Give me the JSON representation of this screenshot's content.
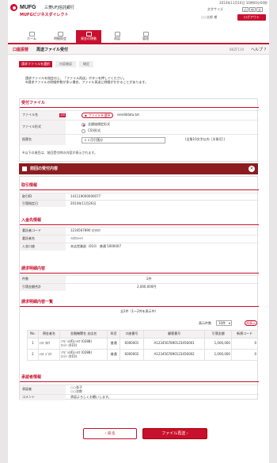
{
  "header": {
    "logo_text": "MUFG",
    "bank_name": "三菱UFJ信託銀行",
    "service_name": "MUFGビジネスダイレクト",
    "datetime": "2014年11月16日 10時00分00秒",
    "font_size_label": "文字サイズ",
    "font_size_options": [
      "小",
      "中",
      "大"
    ],
    "user_text": "○○太郎 様",
    "logout_label": "ログアウト"
  },
  "nav": {
    "items": [
      {
        "label": "ホーム",
        "icon": "home-icon"
      },
      {
        "label": "明細照会",
        "icon": "document-icon"
      },
      {
        "label": "資金の移動",
        "icon": "transfer-icon",
        "active": true
      },
      {
        "label": "承認",
        "icon": "approve-icon"
      },
      {
        "label": "管理",
        "icon": "gear-icon"
      }
    ]
  },
  "titlebar": {
    "section": "口座振替",
    "title": "再送ファイル受付",
    "screen_id": "BKZF119",
    "help": "ヘルプ ?"
  },
  "steps": [
    "請求ファイルを選択",
    "内容確認",
    "確定"
  ],
  "intro": "請求ファイルを指定の上、「ファイル再送」ボタンを押してください。\n※請求ファイルの明細件数が多い場合、ファイル再送に時間がかかることがあります。",
  "upload": {
    "heading": "受付ファイル",
    "file_label": "ファイル名",
    "required": "必須",
    "file_button": "ファイルを選択",
    "file_name": "sendddata.txt",
    "format_label": "ファイル形式",
    "format_options": [
      "全銀協規定形式",
      "CSV形式"
    ],
    "name_label": "振替名",
    "name_value": "１１月引落分",
    "name_hint": "(全角10文字以内［半角可］)",
    "note": "※以下の項目は、前回受付時の内容が表示されます。"
  },
  "prev_bar": "前回の受付内容",
  "prev": {
    "info_heading": "取引情報",
    "info_rows": [
      {
        "label": "取引ID",
        "value": "141119000000077"
      },
      {
        "label": "引落指定日",
        "value": "2014年11月26日"
      }
    ],
    "account_heading": "入金先情報",
    "account_rows": [
      {
        "label": "委託者コード",
        "value": "1234567890 (ｶ)ﾀﾛｳ"
      },
      {
        "label": "委託者名",
        "value": "ｲｼﾀｸｼｬﾒｲ"
      },
      {
        "label": "入金口座",
        "value": "本店営業部（010） 普通 5000007"
      }
    ],
    "summary_heading": "請求明細内容",
    "summary_rows": [
      {
        "label": "件数",
        "value": "2件"
      },
      {
        "label": "引落金額合計",
        "value": "2,000,000円"
      }
    ],
    "list_heading": "請求明細内容一覧",
    "list_count": "全2件（1～2件を表示中）",
    "display_label": "表示件数",
    "display_value": "10件",
    "reshow_label": "再表示",
    "columns": [
      "No.",
      "預金者名",
      "金融機関名 支店名",
      "科目",
      "口座番号",
      "顧客番号",
      "引落金額",
      "新規コード"
    ],
    "rows": [
      {
        "no": "1",
        "name": "ﾃｽﾄ ﾀﾛｳ",
        "bank": "ﾐﾂﾋﾞｼUFJｼﾝﾀｸ (0288)",
        "branch": "ﾎﾝﾃﾝ (010)",
        "type": "普通",
        "account": "6000001",
        "customer": "A1234567890123456001",
        "amount": "1,000,000",
        "code": "0"
      },
      {
        "no": "2",
        "name": "ﾃｽﾄ ｼﾞﾛｳ",
        "bank": "ﾐﾂﾋﾞｼUFJｼﾝﾀｸ (0288)",
        "branch": "ﾎﾝﾃﾝ (010)",
        "type": "普通",
        "account": "6000002",
        "customer": "A1234567890123456002",
        "amount": "1,000,000",
        "code": "0"
      }
    ],
    "approval_heading": "承認者情報",
    "approval_rows": [
      {
        "label": "承認者",
        "value": "○○花子\n○○次郎"
      },
      {
        "label": "コメント",
        "value": "承認よろしくお願いします。"
      }
    ]
  },
  "footer": {
    "back": "戻る",
    "submit": "ファイル再送"
  }
}
